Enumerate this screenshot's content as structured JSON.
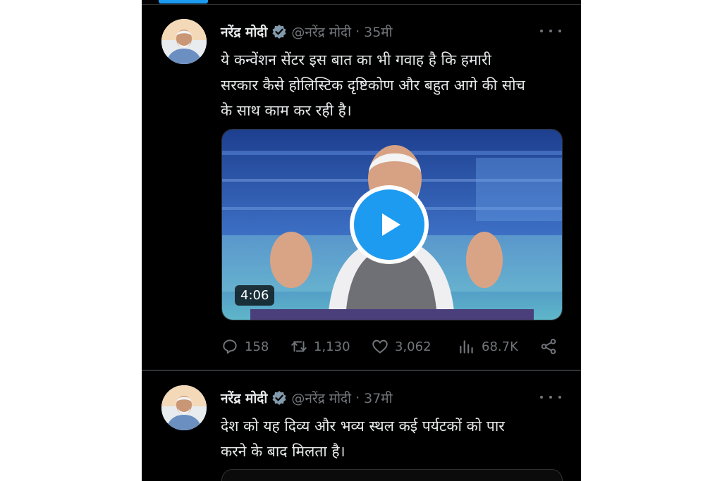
{
  "colors": {
    "background": "#000000",
    "text": "#e7e9ea",
    "muted": "#71767b",
    "accent": "#1d9bf0",
    "divider": "#2f3336"
  },
  "tweets": [
    {
      "name": "नरेंद्र मोदी",
      "handle": "@नरेंद्र मोदी",
      "separator": "·",
      "time": "35मी",
      "text": "ये कन्वेंशन सेंटर इस बात का भी गवाह है कि हमारी\nसरकार कैसे होलिस्टिक दृष्टिकोण और बहुत आगे की सोच\nके साथ काम कर रही है।",
      "video": {
        "duration": "4:06"
      },
      "stats": {
        "replies": "158",
        "retweets": "1,130",
        "likes": "3,062",
        "views": "68.7K"
      }
    },
    {
      "name": "नरेंद्र मोदी",
      "handle": "@नरेंद्र मोदी",
      "separator": "·",
      "time": "37मी",
      "text": "देश को यह दिव्य और भव्य स्थल कई पर्यटकों को पार\nकरने के बाद मिलता है।"
    }
  ]
}
